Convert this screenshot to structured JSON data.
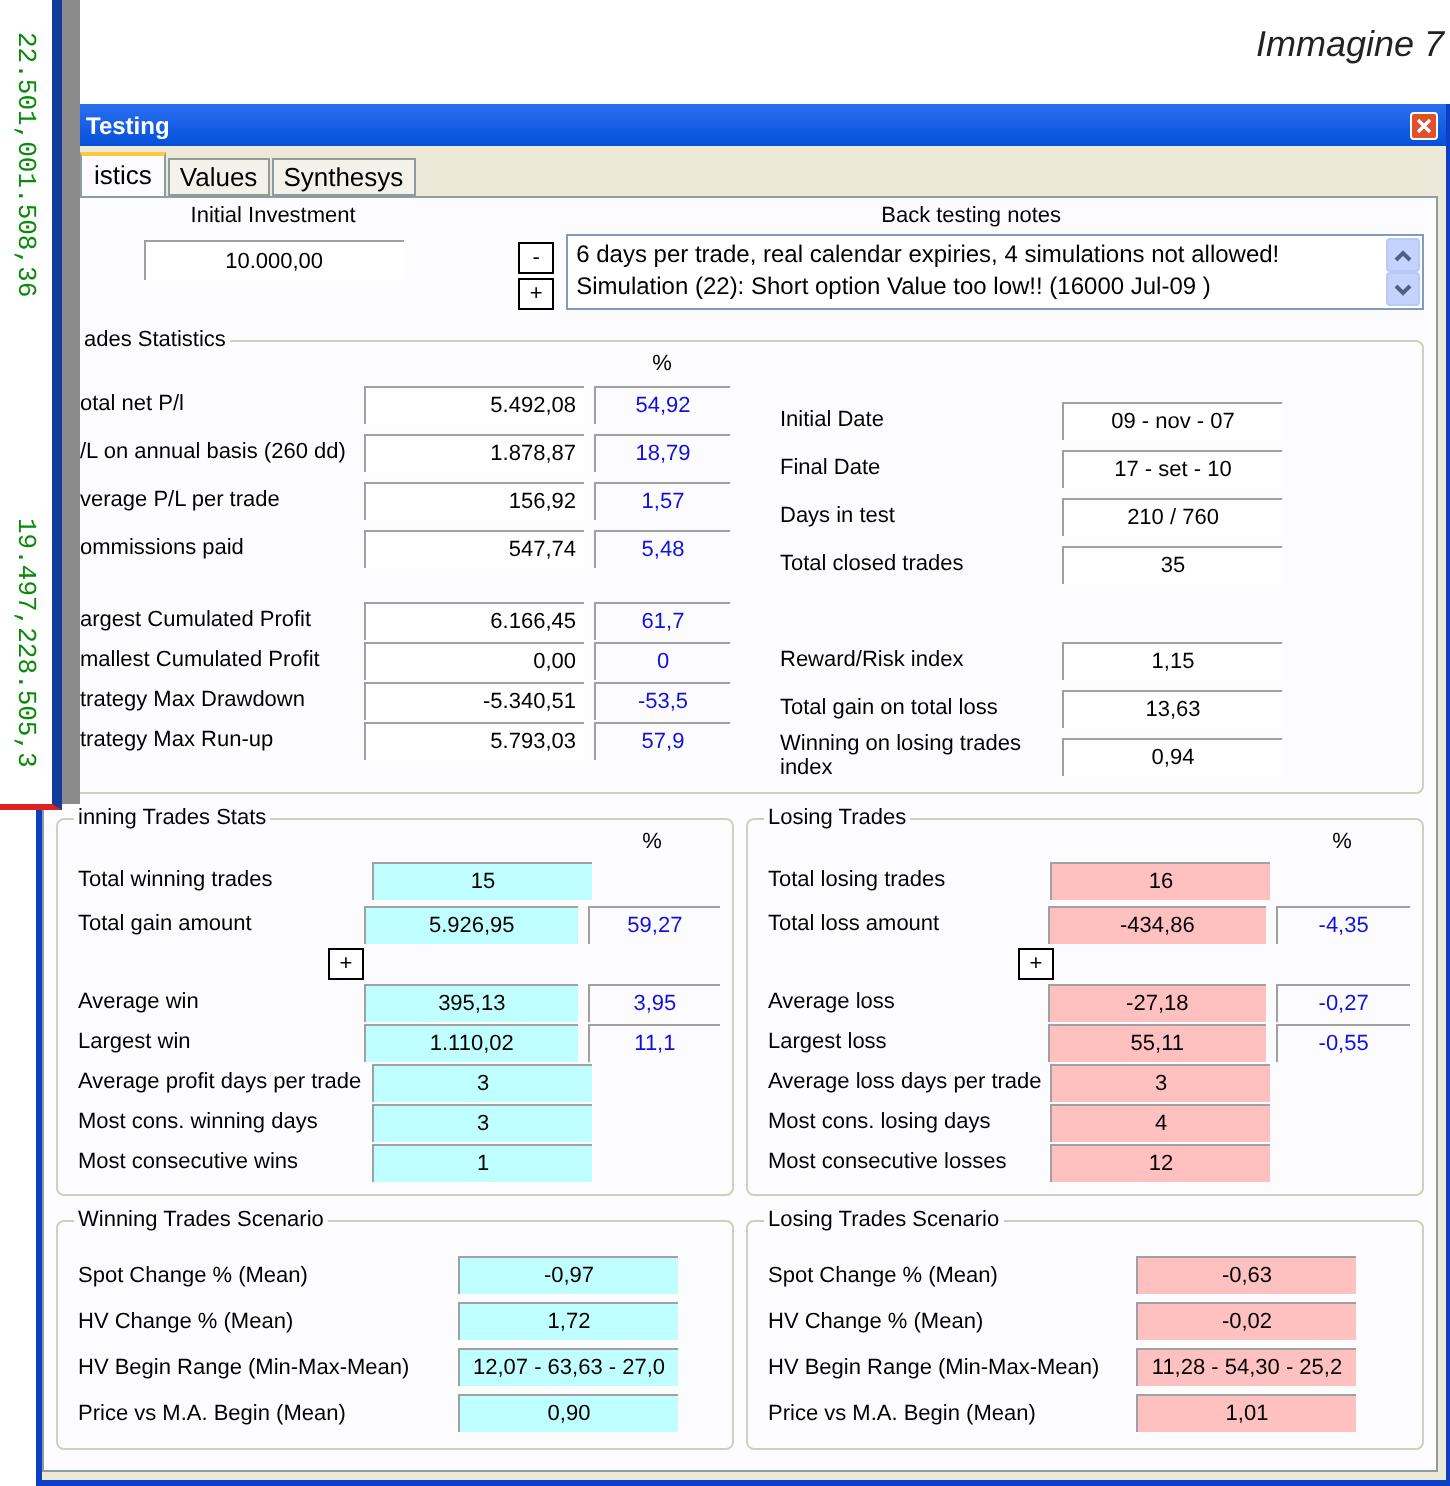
{
  "caption": "Immagine 7",
  "side_window": {
    "readings": [
      "22.501,001.508,36",
      "19.497,228.505,3"
    ]
  },
  "window": {
    "title": "Testing"
  },
  "tabs": [
    {
      "label": "istics",
      "selected": true
    },
    {
      "label": "Values",
      "selected": false
    },
    {
      "label": "Synthesys",
      "selected": false
    }
  ],
  "initial_investment": {
    "label": "Initial Investment",
    "value": "10.000,00"
  },
  "notes": {
    "label": "Back testing notes",
    "buttons": [
      "-",
      "+"
    ],
    "lines": [
      "6 days per trade, real calendar expiries,  4 simulations not allowed!",
      "Simulation (22): Short option Value too low!! (16000 Jul-09 )"
    ]
  },
  "trades_statistics": {
    "title": "ades Statistics",
    "percent_header": "%",
    "left_groups": [
      [
        {
          "label": "otal net P/l",
          "value": "5.492,08",
          "percent": "54,92"
        },
        {
          "label": "/L on annual basis (260 dd)",
          "value": "1.878,87",
          "percent": "18,79"
        },
        {
          "label": "verage P/L per trade",
          "value": "156,92",
          "percent": "1,57"
        },
        {
          "label": "ommissions paid",
          "value": "547,74",
          "percent": "5,48"
        }
      ],
      [
        {
          "label": "argest Cumulated Profit",
          "value": "6.166,45",
          "percent": "61,7"
        },
        {
          "label": "mallest Cumulated Profit",
          "value": "0,00",
          "percent": "0"
        },
        {
          "label": "trategy Max Drawdown",
          "value": "-5.340,51",
          "percent": "-53,5"
        },
        {
          "label": "trategy Max Run-up",
          "value": "5.793,03",
          "percent": "57,9"
        }
      ]
    ],
    "right_groups": [
      [
        {
          "label": "Initial Date",
          "value": "09 - nov - 07"
        },
        {
          "label": "Final Date",
          "value": "17 - set - 10"
        },
        {
          "label": "Days in test",
          "value": "210 / 760"
        },
        {
          "label": "Total closed trades",
          "value": "35"
        }
      ],
      [
        {
          "label": "Reward/Risk index",
          "value": "1,15"
        },
        {
          "label": "Total gain on total loss",
          "value": "13,63"
        },
        {
          "label": "Winning on losing trades index",
          "value": "0,94"
        }
      ]
    ]
  },
  "trade_sections": [
    {
      "kind": "winning",
      "title": "inning Trades Stats",
      "percent_header": "%",
      "expand_button": "+",
      "rows_top": [
        {
          "label": "Total winning trades",
          "value": "15"
        },
        {
          "label": "Total gain amount",
          "value": "5.926,95",
          "percent": "59,27"
        }
      ],
      "rows_bottom": [
        {
          "label": "Average win",
          "value": "395,13",
          "percent": "3,95"
        },
        {
          "label": "Largest win",
          "value": "1.110,02",
          "percent": "11,1"
        },
        {
          "label": "Average profit days per trade",
          "value": "3"
        },
        {
          "label": "Most cons. winning days",
          "value": "3"
        },
        {
          "label": "Most consecutive wins",
          "value": "1"
        }
      ]
    },
    {
      "kind": "losing",
      "title": "Losing Trades",
      "percent_header": "%",
      "expand_button": "+",
      "rows_top": [
        {
          "label": "Total losing trades",
          "value": "16"
        },
        {
          "label": "Total loss amount",
          "value": "-434,86",
          "percent": "-4,35"
        }
      ],
      "rows_bottom": [
        {
          "label": "Average loss",
          "value": "-27,18",
          "percent": "-0,27"
        },
        {
          "label": "Largest loss",
          "value": "55,11",
          "percent": "-0,55"
        },
        {
          "label": "Average loss days per trade",
          "value": "3"
        },
        {
          "label": "Most cons. losing days",
          "value": "4"
        },
        {
          "label": "Most consecutive losses",
          "value": "12"
        }
      ]
    }
  ],
  "scenarios": [
    {
      "kind": "winning",
      "title": "Winning Trades Scenario",
      "rows": [
        {
          "label": "Spot Change %  (Mean)",
          "value": "-0,97"
        },
        {
          "label": "HV Change %  (Mean)",
          "value": "1,72"
        },
        {
          "label": "HV Begin Range (Min-Max-Mean)",
          "value": "12,07 - 63,63 - 27,0"
        },
        {
          "label": "Price vs M.A. Begin (Mean)",
          "value": "0,90"
        }
      ]
    },
    {
      "kind": "losing",
      "title": "Losing Trades Scenario",
      "rows": [
        {
          "label": "Spot Change %  (Mean)",
          "value": "-0,63"
        },
        {
          "label": "HV Change %  (Mean)",
          "value": "-0,02"
        },
        {
          "label": "HV Begin Range (Min-Max-Mean)",
          "value": "11,28 - 54,30 - 25,2"
        },
        {
          "label": "Price vs M.A. Begin (Mean)",
          "value": "1,01"
        }
      ]
    }
  ]
}
